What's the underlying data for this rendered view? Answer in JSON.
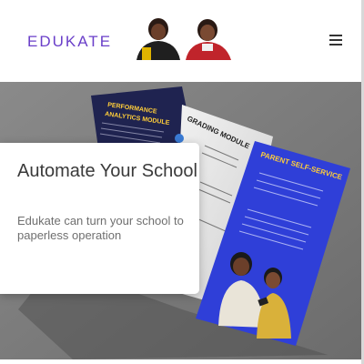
{
  "header": {
    "logo_text": "EDUKATE",
    "menu_icon": "hamburger-menu-icon",
    "brand_color": "#6a3fc9"
  },
  "hero": {
    "title": "Automate Your School",
    "subtitle": "Edukate can turn your school to paperless operation"
  },
  "brochure": {
    "panel_performance_title_line1": "PERFORMANCE",
    "panel_performance_title_line2": "ANALYTICS MODULE",
    "panel_grading_title": "GRADING MODULE",
    "panel_parent_title": "PARENT SELF-SERVICE"
  }
}
